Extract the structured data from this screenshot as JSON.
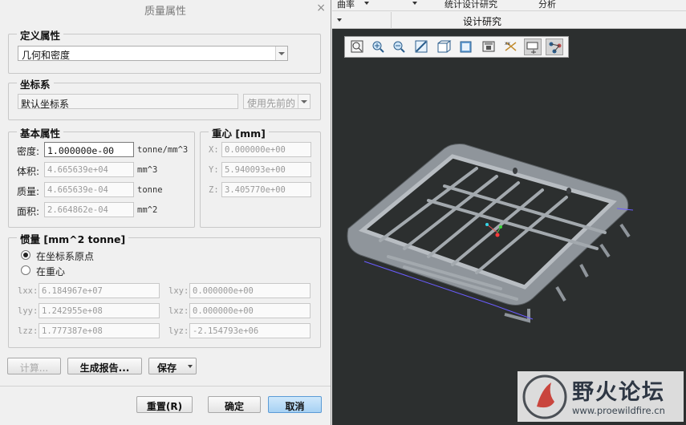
{
  "dialog": {
    "title": "质量属性",
    "close_glyph": "×",
    "define_props": {
      "legend": "定义属性",
      "value": "几何和密度"
    },
    "coord_sys": {
      "legend": "坐标系",
      "value": "默认坐标系",
      "button": "使用先前的"
    },
    "basic_props": {
      "legend": "基本属性",
      "density": {
        "label": "密度:",
        "value": "1.000000e-00",
        "unit": "tonne/mm^3"
      },
      "volume": {
        "label": "体积:",
        "value": "4.665639e+04",
        "unit": "mm^3"
      },
      "mass": {
        "label": "质量:",
        "value": "4.665639e-04",
        "unit": "tonne"
      },
      "area": {
        "label": "面积:",
        "value": "2.664862e-04",
        "unit": "mm^2"
      }
    },
    "centroid": {
      "legend": "重心 [mm]",
      "x": {
        "label": "X:",
        "value": "0.000000e+00"
      },
      "y": {
        "label": "Y:",
        "value": "5.940093e+00"
      },
      "z": {
        "label": "Z:",
        "value": "3.405770e+00"
      }
    },
    "inertia": {
      "legend": "惯量 [mm^2 tonne]",
      "radio_origin": "在坐标系原点",
      "radio_center": "在重心",
      "lxx": {
        "label": "lxx:",
        "value": "6.184967e+07"
      },
      "lyy": {
        "label": "lyy:",
        "value": "1.242955e+08"
      },
      "lzz": {
        "label": "lzz:",
        "value": "1.777387e+08"
      },
      "lxy": {
        "label": "lxy:",
        "value": "0.000000e+00"
      },
      "lxz": {
        "label": "lxz:",
        "value": "0.000000e+00"
      },
      "lyz": {
        "label": "lyz:",
        "value": "-2.154793e+06"
      }
    },
    "actions": {
      "calc": "计算...",
      "report": "生成报告...",
      "save": "保存"
    },
    "footer": {
      "reset": "重置(R)",
      "ok": "确定",
      "cancel": "取消"
    }
  },
  "ribbon": {
    "top_items": [
      "曲率",
      "统计设计研究",
      "分析"
    ],
    "tab_label": "设计研究"
  },
  "watermark": {
    "title": "野火论坛",
    "url": "www.proewildfire.cn"
  },
  "colors": {
    "viewport_bg": "#2c2f2f",
    "model": "#9aa0a6",
    "accent_blue": "#a7d1f3"
  }
}
